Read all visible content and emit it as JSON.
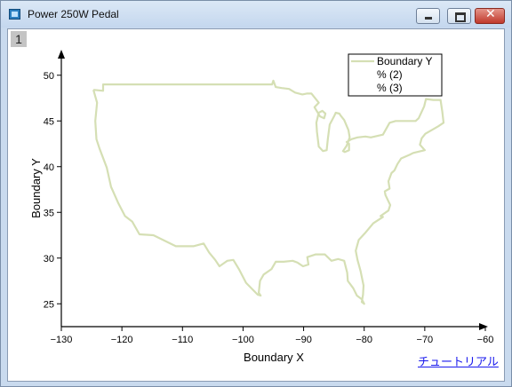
{
  "window": {
    "title": "Power 250W Pedal",
    "minimize_icon": "minimize-icon",
    "maximize_icon": "maximize-icon",
    "close_icon": "close-icon",
    "close_glyph": "✕"
  },
  "graph": {
    "layer_label": "1",
    "tutorial_link": "チュートリアル"
  },
  "chart_data": {
    "type": "line",
    "xlabel": "Boundary X",
    "ylabel": "Boundary Y",
    "xlim": [
      -130,
      -60
    ],
    "ylim": [
      22.5,
      52.5
    ],
    "xticks": [
      -130,
      -120,
      -110,
      -100,
      -90,
      -80,
      -70,
      -60
    ],
    "xtick_labels": [
      "−130",
      "−120",
      "−110",
      "−100",
      "−90",
      "−80",
      "−70",
      "−60"
    ],
    "yticks": [
      25,
      30,
      35,
      40,
      45,
      50
    ],
    "ytick_labels": [
      "25",
      "30",
      "35",
      "40",
      "45",
      "50"
    ],
    "line_color": "#d5dfb4",
    "legend": {
      "placement": "top-right",
      "entries": [
        "Boundary Y",
        "% (2)",
        "% (3)"
      ]
    },
    "series": [
      {
        "name": "Boundary Y",
        "x": [
          -124.7,
          -123.1,
          -123.1,
          -95.2,
          -95.0,
          -94.6,
          -93.6,
          -92.4,
          -91.4,
          -90.2,
          -89.5,
          -88.7,
          -87.5,
          -88.2,
          -87.3,
          -86.6,
          -86.4,
          -86.9,
          -87.5,
          -87.9,
          -87.8,
          -87.5,
          -86.8,
          -86.2,
          -86.0,
          -85.7,
          -84.9,
          -84.7,
          -84.1,
          -83.9,
          -83.3,
          -82.6,
          -82.4,
          -82.9,
          -83.5,
          -83.2,
          -82.5,
          -82.5,
          -82.9,
          -82.1,
          -81.1,
          -79.8,
          -78.9,
          -76.9,
          -75.8,
          -74.8,
          -71.5,
          -71.0,
          -70.1,
          -69.8,
          -68.6,
          -67.4,
          -67.1,
          -66.9,
          -67.8,
          -69.9,
          -70.5,
          -70.8,
          -70.0,
          -71.9,
          -72.5,
          -73.9,
          -74.5,
          -75.0,
          -75.5,
          -76.0,
          -75.8,
          -76.6,
          -76.5,
          -75.7,
          -76.0,
          -77.3,
          -76.9,
          -78.5,
          -79.9,
          -80.9,
          -81.4,
          -81.1,
          -80.6,
          -80.1,
          -80.2,
          -80.4,
          -80.0,
          -80.4,
          -81.2,
          -81.8,
          -82.7,
          -82.8,
          -83.3,
          -84.3,
          -85.4,
          -86.5,
          -88.0,
          -89.4,
          -89.2,
          -90.1,
          -91.0,
          -91.8,
          -93.3,
          -94.6,
          -95.3,
          -96.6,
          -97.2,
          -97.4,
          -97.1,
          -97.6,
          -99.5,
          -100.6,
          -101.6,
          -102.6,
          -103.9,
          -104.6,
          -105.6,
          -106.5,
          -108.2,
          -111.1,
          -114.8,
          -117.1,
          -118.3,
          -119.5,
          -120.6,
          -121.8,
          -122.5,
          -123.7,
          -124.2,
          -124.4,
          -124.1,
          -124.7
        ],
        "y": [
          48.4,
          48.3,
          49.0,
          49.0,
          49.4,
          48.7,
          48.6,
          48.5,
          48.1,
          47.9,
          48.0,
          48.0,
          47.0,
          46.5,
          45.5,
          45.3,
          45.8,
          46.1,
          45.9,
          44.8,
          43.8,
          42.2,
          41.7,
          41.8,
          43.0,
          44.6,
          45.6,
          45.9,
          45.8,
          45.6,
          45.1,
          44.0,
          43.2,
          42.3,
          41.7,
          41.6,
          41.8,
          42.5,
          42.7,
          43.0,
          43.2,
          43.3,
          43.2,
          43.5,
          44.8,
          45.0,
          45.0,
          45.3,
          46.6,
          47.4,
          47.3,
          47.3,
          46.0,
          44.8,
          44.4,
          43.6,
          43.1,
          42.4,
          41.8,
          41.5,
          41.3,
          40.9,
          40.3,
          39.6,
          39.3,
          38.4,
          37.6,
          37.3,
          36.9,
          35.8,
          35.2,
          34.6,
          34.5,
          33.8,
          32.7,
          32.0,
          30.8,
          29.8,
          28.6,
          27.0,
          26.0,
          25.2,
          25.0,
          25.5,
          25.9,
          26.7,
          27.5,
          28.4,
          29.7,
          29.9,
          29.7,
          30.4,
          30.4,
          30.1,
          29.3,
          29.1,
          29.5,
          29.7,
          29.6,
          29.6,
          28.8,
          28.2,
          27.5,
          26.2,
          25.9,
          26.0,
          27.3,
          28.7,
          29.8,
          29.7,
          29.1,
          29.8,
          30.6,
          31.6,
          31.3,
          31.3,
          32.5,
          32.6,
          34.0,
          34.6,
          36.0,
          37.8,
          39.9,
          42.0,
          43.0,
          45.0,
          47.0,
          48.4
        ]
      }
    ]
  }
}
